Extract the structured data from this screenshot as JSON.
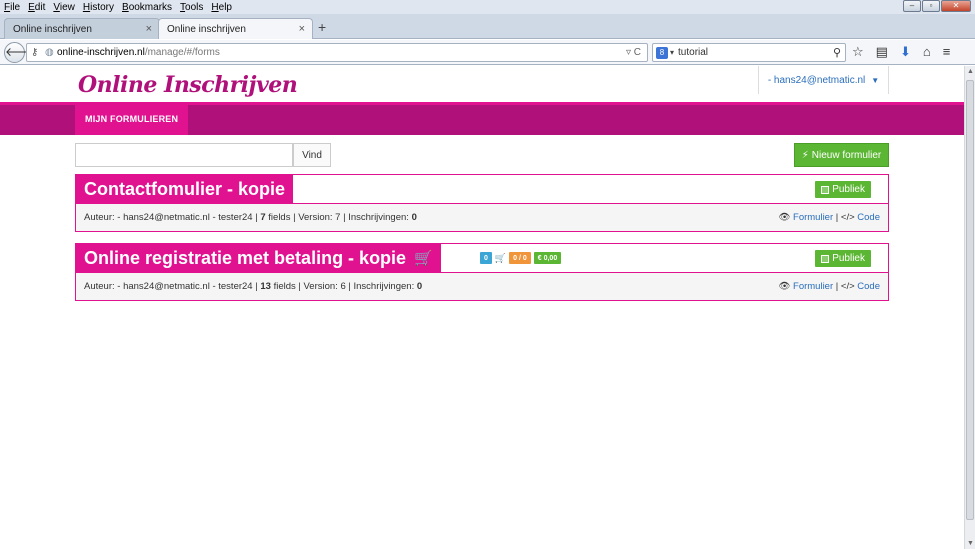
{
  "menubar": {
    "items": [
      "File",
      "Edit",
      "View",
      "History",
      "Bookmarks",
      "Tools",
      "Help"
    ]
  },
  "tabs": [
    {
      "label": "Online inschrijven"
    },
    {
      "label": "Online inschrijven"
    }
  ],
  "nav": {
    "url_host": "online-inschrijven.nl",
    "url_path": "/manage/#/forms",
    "search_value": "tutorial"
  },
  "site": {
    "logo": "Online Inschrijven",
    "user": "- hans24@netmatic.nl",
    "tab_label": "MIJN FORMULIEREN"
  },
  "toolbar": {
    "search_placeholder": "",
    "find_label": "Vind",
    "new_label": "Nieuw formulier"
  },
  "forms": [
    {
      "title": "Contactfomulier - kopie",
      "publish_label": "Publiek",
      "author": "Auteur: - hans24@netmatic.nl - tester24 |",
      "fields": "7",
      "fields_label": "fields | Version: 7 | Inschrijvingen:",
      "registrations": "0",
      "form_link": "Formulier",
      "code_link": "Code"
    },
    {
      "title": "Online registratie met betaling - kopie",
      "publish_label": "Publiek",
      "author": "Auteur: - hans24@netmatic.nl - tester24 |",
      "fields": "13",
      "fields_label": "fields | Version: 6 | Inschrijvingen:",
      "registrations": "0",
      "form_link": "Formulier",
      "code_link": "Code",
      "badges": {
        "count": "0",
        "ratio": "0 / 0",
        "amount": "€ 0,00"
      }
    }
  ],
  "colors": {
    "brand": "#b0107a",
    "accent": "#e0128f",
    "success": "#5bb633",
    "link": "#2a6ebb"
  }
}
